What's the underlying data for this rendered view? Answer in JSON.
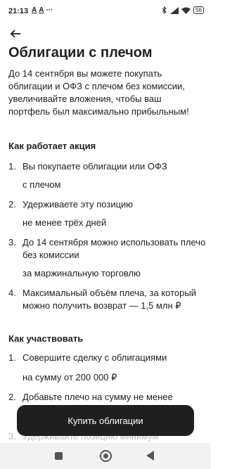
{
  "status": {
    "time": "21:13",
    "notif_a1": "A",
    "notif_a2": "A",
    "notif_more": "···",
    "battery": "56"
  },
  "page": {
    "title": "Облигации с плечом",
    "intro": "До 14 сентября вы можете покупать облигации и ОФЗ с плечом без комиссии, увеличивайте вложения, чтобы ваш портфель был максимально прибыльным!"
  },
  "how_it_works": {
    "heading": "Как работает акция",
    "items": [
      {
        "num": "1.",
        "text": "Вы покупаете облигации или ОФЗ",
        "sub": "с плечом"
      },
      {
        "num": "2.",
        "text": "Удерживаете эту позицию",
        "sub": "не менее трёх дней"
      },
      {
        "num": "3.",
        "text": "До 14 сентября можно использовать плечо без комиссии",
        "sub": "за маржинальную торговлю"
      },
      {
        "num": "4.",
        "text": "Максимальный объём плеча, за который можно получить возврат — 1,5 млн ₽"
      }
    ]
  },
  "how_to_join": {
    "heading": "Как участвовать",
    "items": [
      {
        "num": "1.",
        "text": "Совершите сделку с облигациями",
        "sub": "на сумму от 200 000 ₽"
      },
      {
        "num": "2.",
        "text": "Добавьте плечо на сумму не менее"
      },
      {
        "num": "3.",
        "text": "Удерживайте позицию минимум"
      }
    ]
  },
  "cta": {
    "label": "Купить облигации"
  }
}
